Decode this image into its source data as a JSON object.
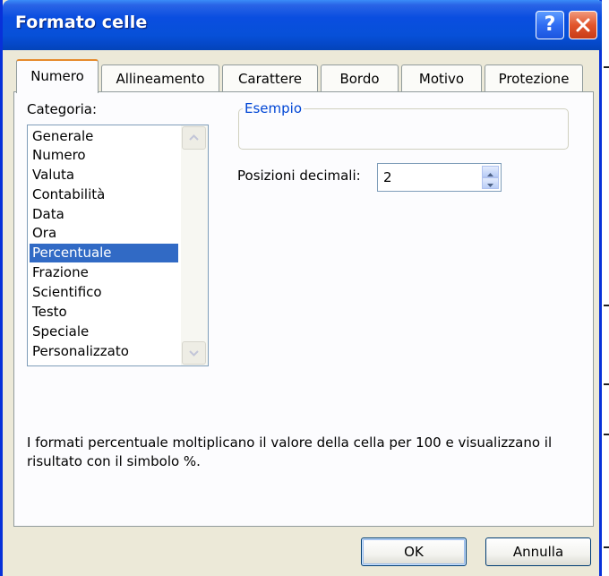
{
  "window": {
    "title": "Formato celle",
    "help_glyph": "?",
    "close_icon": "close-icon"
  },
  "tabs": [
    {
      "label": "Numero",
      "active": true
    },
    {
      "label": "Allineamento",
      "active": false
    },
    {
      "label": "Carattere",
      "active": false
    },
    {
      "label": "Bordo",
      "active": false
    },
    {
      "label": "Motivo",
      "active": false
    },
    {
      "label": "Protezione",
      "active": false
    }
  ],
  "category": {
    "label": "Categoria:",
    "items": [
      "Generale",
      "Numero",
      "Valuta",
      "Contabilità",
      "Data",
      "Ora",
      "Percentuale",
      "Frazione",
      "Scientifico",
      "Testo",
      "Speciale",
      "Personalizzato"
    ],
    "selected": "Percentuale"
  },
  "sample": {
    "label": "Esempio",
    "value": ""
  },
  "decimals": {
    "label": "Posizioni decimali:",
    "value": "2"
  },
  "description": "I formati percentuale moltiplicano il valore della cella per 100 e visualizzano il risultato con il simbolo %.",
  "buttons": {
    "ok": "OK",
    "cancel": "Annulla"
  },
  "colors": {
    "titlebar": "#0a4ee0",
    "selection": "#316ac5",
    "active_tab_accent": "#e68b2c",
    "group_label": "#0046d5"
  }
}
